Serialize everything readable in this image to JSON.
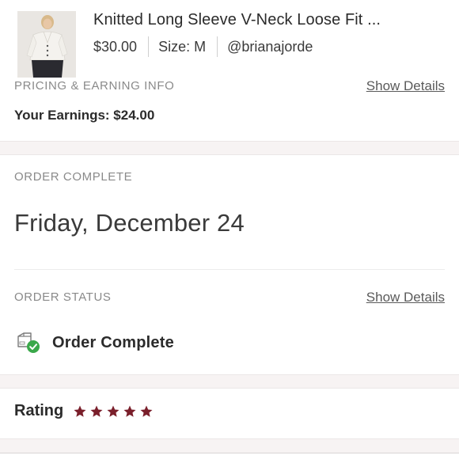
{
  "product": {
    "title": "Knitted Long Sleeve V-Neck Loose Fit ...",
    "price": "$30.00",
    "size": "Size: M",
    "seller": "@brianajorde"
  },
  "pricing": {
    "label": "PRICING & EARNING INFO",
    "show_details": "Show Details",
    "earnings": "Your Earnings: $24.00"
  },
  "order_complete": {
    "label": "ORDER COMPLETE",
    "date": "Friday, December 24"
  },
  "order_status": {
    "label": "ORDER STATUS",
    "show_details": "Show Details",
    "status": "Order Complete",
    "icon": "package-check-icon",
    "check_color": "#3aa84a"
  },
  "rating": {
    "label": "Rating",
    "stars": 5,
    "max_stars": 5,
    "star_color": "#7a1f2b"
  }
}
